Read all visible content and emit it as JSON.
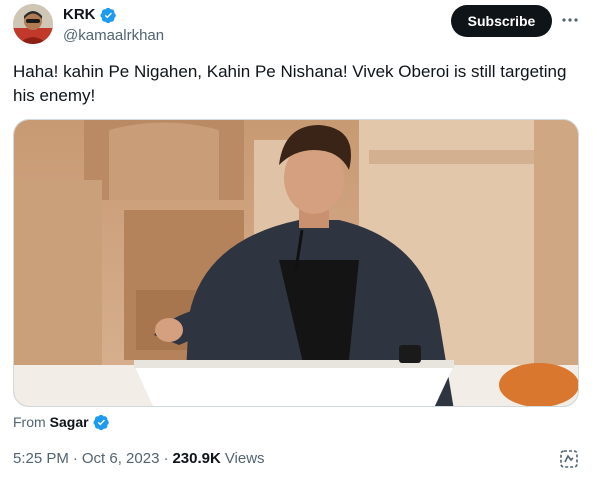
{
  "author": {
    "name": "KRK",
    "handle": "@kamaalrkhan",
    "verified": true
  },
  "actions": {
    "subscribe_label": "Subscribe",
    "more_icon": "more-dots-icon"
  },
  "tweet": {
    "text": "Haha! kahin Pe Nigahen, Kahin Pe Nishana! Vivek Oberoi is still targeting his enemy!"
  },
  "media": {
    "type": "video-thumbnail"
  },
  "attribution": {
    "prefix": "From",
    "source_name": "Sagar",
    "verified": true
  },
  "meta": {
    "time": "5:25 PM",
    "date": "Oct 6, 2023",
    "views_count": "230.9K",
    "views_label": "Views",
    "dot": "·"
  },
  "colors": {
    "verified_blue": "#1d9bf0",
    "text_primary": "#0f1419",
    "text_secondary": "#536471",
    "subscribe_bg": "#0f1419"
  }
}
